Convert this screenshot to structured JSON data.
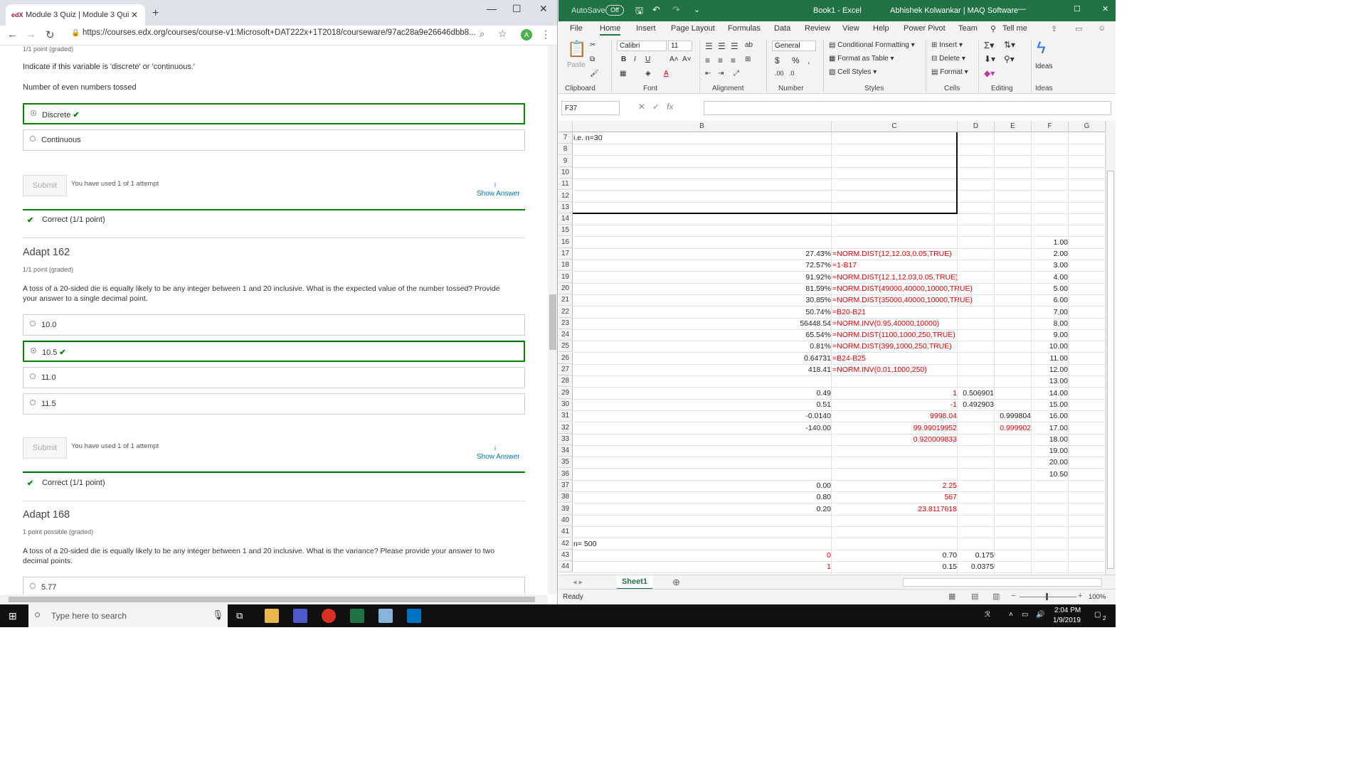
{
  "browser": {
    "tab_title": "Module 3 Quiz | Module 3 Quiz |",
    "tab_icon_text": "edX",
    "url": "https://courses.edx.org/courses/course-v1:Microsoft+DAT222x+1T2018/courseware/97ac28a9e26646dbb8...",
    "avatar": "A",
    "window_controls": [
      "—",
      "☐",
      "✕"
    ]
  },
  "quiz": {
    "top_meta": "1/1 point (graded)",
    "q1_prompt": "Indicate if this variable is 'discrete' or 'continuous.'",
    "q1_variable": "Number of even numbers tossed",
    "q1_options": [
      "Discrete",
      "Continuous"
    ],
    "q1_selected": "Discrete",
    "submit_label": "Submit",
    "attempts": "You have used 1 of 1 attempt",
    "info_icon": "i",
    "show_answer": "Show Answer",
    "correct": "Correct (1/1 point)",
    "q2_title": "Adapt 162",
    "q2_meta": "1/1 point (graded)",
    "q2_line1": "A toss of a 20-sided die is equally likely to be any integer between 1 and 20 inclusive. What is the expected value of the number tossed? Provide",
    "q2_line2": "your answer to a single decimal point.",
    "q2_options": [
      "10.0",
      "10.5",
      "11.0",
      "11.5"
    ],
    "q2_selected": "10.5",
    "q3_title": "Adapt 168",
    "q3_meta": "1 point possible (graded)",
    "q3_line1": "A toss of a 20-sided die is equally likely to be any integer between 1 and 20 inclusive. What is the variance? Please provide your answer to two",
    "q3_line2": "decimal points.",
    "q3_options": [
      "5.77"
    ]
  },
  "excel": {
    "autosave": "AutoSave",
    "autosave_state": "Off",
    "title": "Book1  -  Excel",
    "user": "Abhishek Kolwankar | MAQ Software",
    "tabs": [
      "File",
      "Home",
      "Insert",
      "Page Layout",
      "Formulas",
      "Data",
      "Review",
      "View",
      "Help",
      "Power Pivot",
      "Team",
      "Tell me"
    ],
    "font_name": "Calibri",
    "font_size": "11",
    "number_format": "General",
    "paste": "Paste",
    "styles": [
      "Conditional Formatting",
      "Format as Table",
      "Cell Styles"
    ],
    "cells_grp": [
      "Insert",
      "Delete",
      "Format"
    ],
    "ideas": "Ideas",
    "group_labels": [
      "Clipboard",
      "Font",
      "Alignment",
      "Number",
      "Styles",
      "Cells",
      "Editing",
      "Ideas"
    ],
    "namebox": "F37",
    "fx": "fx",
    "columns": [
      "B",
      "C",
      "D",
      "E",
      "F",
      "G"
    ],
    "rows": [
      {
        "n": "7",
        "B": "i.e. n=30"
      },
      {
        "n": "8"
      },
      {
        "n": "9"
      },
      {
        "n": "10"
      },
      {
        "n": "11"
      },
      {
        "n": "12"
      },
      {
        "n": "13"
      },
      {
        "n": "14"
      },
      {
        "n": "15"
      },
      {
        "n": "16",
        "F": "1.00"
      },
      {
        "n": "17",
        "B": "27.43%",
        "C": "=NORM.DIST(12,12.03,0.05,TRUE)",
        "F": "2.00"
      },
      {
        "n": "18",
        "B": "72.57%",
        "C": "=1-B17",
        "F": "3.00"
      },
      {
        "n": "19",
        "B": "91.92%",
        "C": "=NORM.DIST(12.1,12.03,0.05,TRUE)",
        "F": "4.00"
      },
      {
        "n": "20",
        "B": "81.59%",
        "C": "=NORM.DIST(49000,40000,10000,TRUE)",
        "F": "5.00"
      },
      {
        "n": "21",
        "B": "30.85%",
        "C": "=NORM.DIST(35000,40000,10000,TRUE)",
        "F": "6.00"
      },
      {
        "n": "22",
        "B": "50.74%",
        "C": "=B20-B21",
        "F": "7.00"
      },
      {
        "n": "23",
        "B": "56448.54",
        "C": "=NORM.INV(0.95,40000,10000)",
        "F": "8.00"
      },
      {
        "n": "24",
        "B": "65.54%",
        "C": "=NORM.DIST(1100,1000,250,TRUE)",
        "F": "9.00"
      },
      {
        "n": "25",
        "B": "0.81%",
        "C": "=NORM.DIST(399,1000,250,TRUE)",
        "F": "10.00"
      },
      {
        "n": "26",
        "B": "0.64731",
        "C": "=B24-B25",
        "F": "11.00"
      },
      {
        "n": "27",
        "B": "418.41",
        "C": "=NORM.INV(0.01,1000,250)",
        "F": "12.00"
      },
      {
        "n": "28",
        "F": "13.00"
      },
      {
        "n": "29",
        "B": "0.49",
        "C": "1",
        "D": "0.506901",
        "F": "14.00"
      },
      {
        "n": "30",
        "B": "0.51",
        "C": "-1",
        "D": "0.492903",
        "F": "15.00"
      },
      {
        "n": "31",
        "B": "-0.0140",
        "C": "9998.04",
        "E": "0.999804",
        "F": "16.00"
      },
      {
        "n": "32",
        "B": "-140.00",
        "C": "99.99019952",
        "E": "0.999902",
        "F": "17.00"
      },
      {
        "n": "33",
        "C": "0.920009833",
        "F": "18.00"
      },
      {
        "n": "34",
        "F": "19.00"
      },
      {
        "n": "35",
        "F": "20.00"
      },
      {
        "n": "36",
        "F": "10.50"
      },
      {
        "n": "37",
        "B": "0.00",
        "C": "2.25"
      },
      {
        "n": "38",
        "B": "0.80",
        "C": "567"
      },
      {
        "n": "39",
        "B": "0.20",
        "C": "23.8117618"
      },
      {
        "n": "40"
      },
      {
        "n": "41"
      },
      {
        "n": "42",
        "B": "n= 500"
      },
      {
        "n": "43",
        "B": "0",
        "C": "0.70",
        "D": "0.175"
      },
      {
        "n": "44",
        "B": "1",
        "C": "0.15",
        "D": "0.0375"
      }
    ],
    "sheet": "Sheet1",
    "status": "Ready",
    "zoom": "100%"
  },
  "taskbar": {
    "search": "Type here to search",
    "time": "2:04 PM",
    "date": "1/9/2019",
    "notif": "2"
  }
}
